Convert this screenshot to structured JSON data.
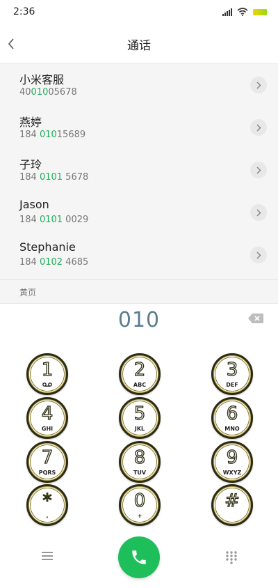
{
  "status_bar": {
    "time": "2:36"
  },
  "header": {
    "title": "通话"
  },
  "contacts": [
    {
      "name": "小米客服",
      "number_pre": "40",
      "number_match": "010",
      "number_post": "05678"
    },
    {
      "name": "燕婷",
      "number_pre": "184 ",
      "number_match": "010",
      "number_post": "15689"
    },
    {
      "name": "子玲",
      "number_pre": "184 ",
      "number_match": "0101",
      "number_post": " 5678"
    },
    {
      "name": "Jason",
      "number_pre": "184 ",
      "number_match": "0101",
      "number_post": " 0029"
    },
    {
      "name": "Stephanie",
      "number_pre": "184 ",
      "number_match": "0102",
      "number_post": " 4685"
    }
  ],
  "section_label": "黄页",
  "dial": {
    "input": "010"
  },
  "keys": [
    {
      "digit": "1",
      "letters": "ᅇ"
    },
    {
      "digit": "2",
      "letters": "ABC"
    },
    {
      "digit": "3",
      "letters": "DEF"
    },
    {
      "digit": "4",
      "letters": "GHI"
    },
    {
      "digit": "5",
      "letters": "JKL"
    },
    {
      "digit": "6",
      "letters": "MNO"
    },
    {
      "digit": "7",
      "letters": "PQRS"
    },
    {
      "digit": "8",
      "letters": "TUV"
    },
    {
      "digit": "9",
      "letters": "WXYZ"
    },
    {
      "digit": "*",
      "letters": ","
    },
    {
      "digit": "0",
      "letters": "+"
    },
    {
      "digit": "#",
      "letters": ""
    }
  ],
  "colors": {
    "match_highlight": "#1fae5a",
    "call_button": "#1ebf5b",
    "dial_text": "#5a7d8f"
  }
}
